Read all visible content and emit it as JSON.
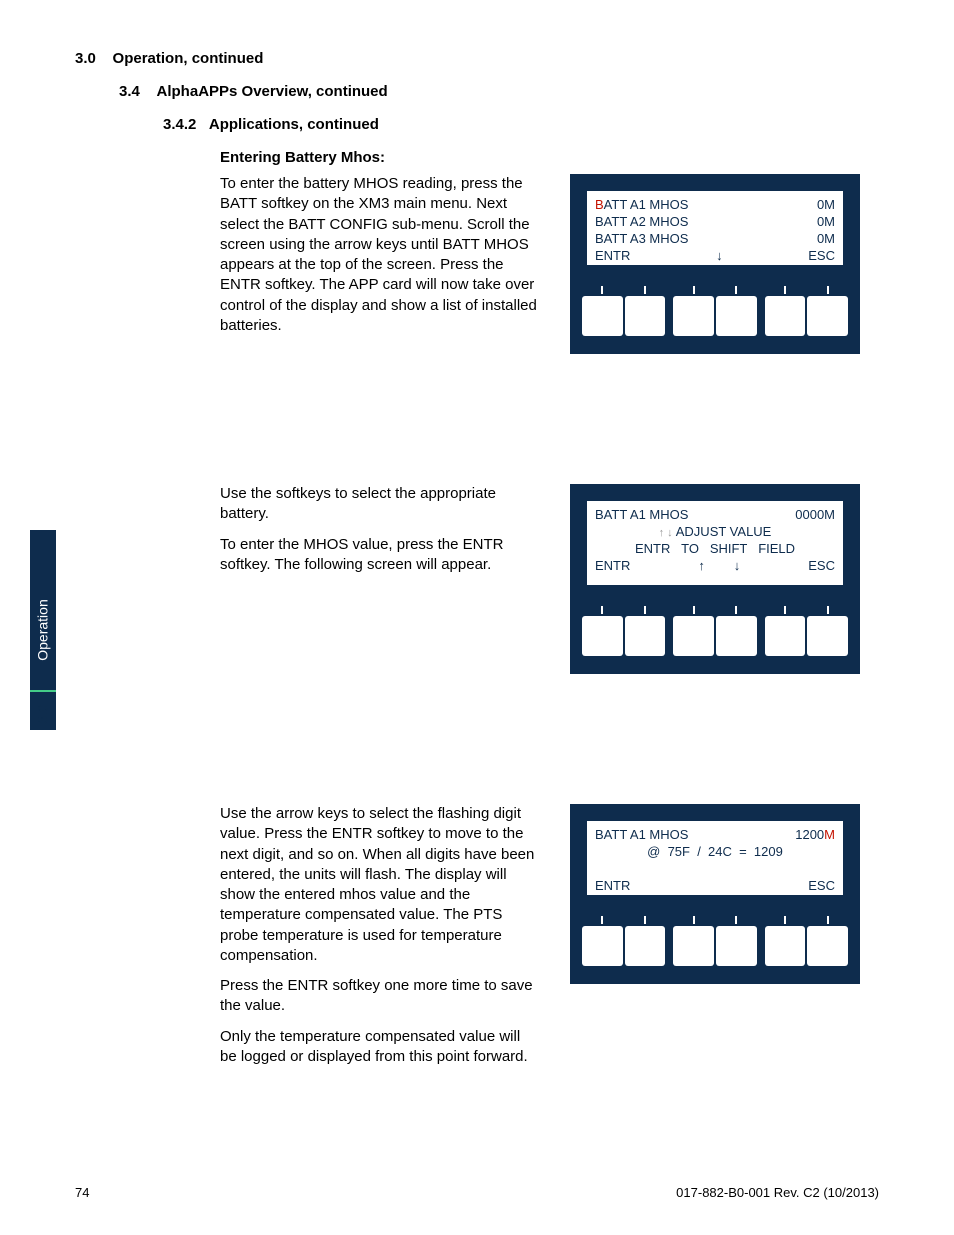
{
  "sideTab": {
    "label": "Operation",
    "num": "3.0"
  },
  "headings": {
    "h1": "3.0    Operation, continued",
    "h2": "3.4    AlphaAPPs Overview, continued",
    "h3": "3.4.2   Applications, continued",
    "h4": "Entering Battery Mhos:"
  },
  "section1": {
    "para": "To enter the battery MHOS reading, press the BATT softkey on the XM3 main menu.  Next select the BATT CONFIG sub-menu. Scroll the screen using the arrow keys until BATT MHOS appears at the top of the screen.  Press the ENTR softkey.  The APP card will now take over control of the display and show a list of installed batteries.",
    "screen": {
      "r1l_first": "B",
      "r1l_rest": "ATT A1 MHOS",
      "r1r": "0M",
      "r2l": "BATT A2 MHOS",
      "r2r": "0M",
      "r3l": "BATT A3 MHOS",
      "r3r": "0M",
      "r4l": "ENTR",
      "r4r": "ESC"
    }
  },
  "section2": {
    "para1": "Use the softkeys to select the appropriate battery.",
    "para2": "To enter the MHOS value, press the ENTR softkey.  The following screen will appear.",
    "screen": {
      "r1l": "BATT A1 MHOS",
      "r1r": "0000M",
      "r2c": "ADJUST VALUE",
      "r3c": "ENTR   TO   SHIFT   FIELD",
      "r4l": "ENTR",
      "r4r": "ESC"
    }
  },
  "section3": {
    "para1": "Use the arrow keys to select the flashing digit value.  Press the ENTR softkey to move to the next digit, and so on.  When all digits have been entered, the units will flash.  The display will show the entered mhos value and the temperature compensated value. The PTS probe temperature is used for temperature compensation.",
    "para2": "Press the ENTR softkey one more time to save the value.",
    "para3": "Only the temperature compensated value will be logged or displayed from this point forward.",
    "screen": {
      "r1l": "BATT A1 MHOS",
      "r1r_num": "1200",
      "r1r_unit": "M",
      "r2c": "@  75F  /  24C  =  1209",
      "r4l": "ENTR",
      "r4r": "ESC"
    }
  },
  "footer": {
    "page": "74",
    "rev": "017-882-B0-001 Rev. C2 (10/2013)"
  }
}
